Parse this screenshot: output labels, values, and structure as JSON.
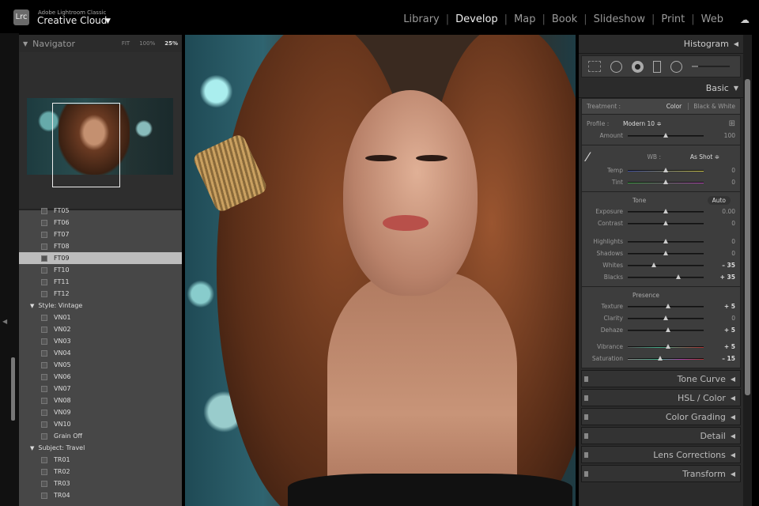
{
  "app": {
    "subtitle": "Adobe Lightroom Classic",
    "title": "Creative Cloud",
    "logo": "Lrc"
  },
  "modules": [
    "Library",
    "Develop",
    "Map",
    "Book",
    "Slideshow",
    "Print",
    "Web"
  ],
  "active_module": "Develop",
  "navigator": {
    "title": "Navigator",
    "fit": "FIT",
    "z100": "100%",
    "z25": "25%"
  },
  "presets": [
    {
      "label": "FT05",
      "type": "item"
    },
    {
      "label": "FT06",
      "type": "item"
    },
    {
      "label": "FT07",
      "type": "item"
    },
    {
      "label": "FT08",
      "type": "item"
    },
    {
      "label": "FT09",
      "type": "item",
      "selected": true
    },
    {
      "label": "FT10",
      "type": "item"
    },
    {
      "label": "FT11",
      "type": "item"
    },
    {
      "label": "FT12",
      "type": "item"
    },
    {
      "label": "Style: Vintage",
      "type": "group"
    },
    {
      "label": "VN01",
      "type": "item"
    },
    {
      "label": "VN02",
      "type": "item"
    },
    {
      "label": "VN03",
      "type": "item"
    },
    {
      "label": "VN04",
      "type": "item"
    },
    {
      "label": "VN05",
      "type": "item"
    },
    {
      "label": "VN06",
      "type": "item"
    },
    {
      "label": "VN07",
      "type": "item"
    },
    {
      "label": "VN08",
      "type": "item"
    },
    {
      "label": "VN09",
      "type": "item"
    },
    {
      "label": "VN10",
      "type": "item"
    },
    {
      "label": "Grain Off",
      "type": "item"
    },
    {
      "label": "Subject: Travel",
      "type": "group"
    },
    {
      "label": "TR01",
      "type": "item"
    },
    {
      "label": "TR02",
      "type": "item"
    },
    {
      "label": "TR03",
      "type": "item"
    },
    {
      "label": "TR04",
      "type": "item"
    }
  ],
  "right": {
    "histogram": "Histogram",
    "basic": "Basic",
    "treatment": {
      "label": "Treatment :",
      "color": "Color",
      "bw": "Black & White"
    },
    "profile": {
      "label": "Profile :",
      "value": "Modern 10 ≑"
    },
    "amount": {
      "label": "Amount",
      "value": "100",
      "pos": 0.5
    },
    "wb": {
      "label": "WB :",
      "value": "As Shot ≑"
    },
    "wb_sliders": [
      {
        "label": "Temp",
        "value": "0",
        "pos": 0.5
      },
      {
        "label": "Tint",
        "value": "0",
        "pos": 0.5
      }
    ],
    "tone": {
      "label": "Tone",
      "auto": "Auto"
    },
    "tone_sliders": [
      {
        "label": "Exposure",
        "value": "0.00",
        "pos": 0.5
      },
      {
        "label": "Contrast",
        "value": "0",
        "pos": 0.5
      }
    ],
    "tone_sliders2": [
      {
        "label": "Highlights",
        "value": "0",
        "pos": 0.5
      },
      {
        "label": "Shadows",
        "value": "0",
        "pos": 0.5
      },
      {
        "label": "Whites",
        "value": "– 35",
        "pos": 0.34,
        "bold": true
      },
      {
        "label": "Blacks",
        "value": "+ 35",
        "pos": 0.67,
        "bold": true
      }
    ],
    "presence": {
      "label": "Presence"
    },
    "presence_sliders": [
      {
        "label": "Texture",
        "value": "+ 5",
        "pos": 0.53,
        "bold": true
      },
      {
        "label": "Clarity",
        "value": "0",
        "pos": 0.5
      },
      {
        "label": "Dehaze",
        "value": "+ 5",
        "pos": 0.53,
        "bold": true
      }
    ],
    "presence_sliders2": [
      {
        "label": "Vibrance",
        "value": "+ 5",
        "pos": 0.53,
        "bold": true
      },
      {
        "label": "Saturation",
        "value": "– 15",
        "pos": 0.43,
        "bold": true
      }
    ],
    "panels": [
      "Tone Curve",
      "HSL / Color",
      "Color Grading",
      "Detail",
      "Lens Corrections",
      "Transform"
    ]
  }
}
